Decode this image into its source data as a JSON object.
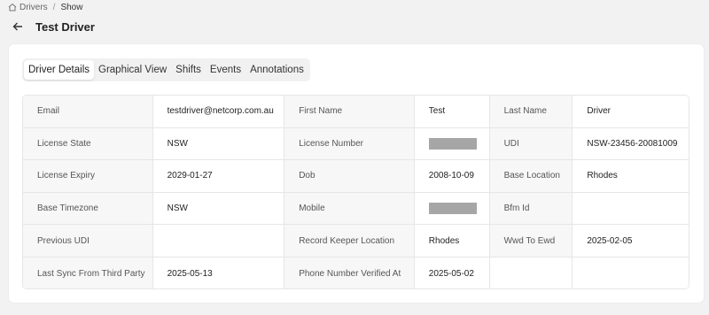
{
  "breadcrumb": {
    "root": "Drivers",
    "separator": "/",
    "current": "Show"
  },
  "page": {
    "title": "Test Driver"
  },
  "tabs": [
    {
      "label": "Driver Details",
      "active": true
    },
    {
      "label": "Graphical View",
      "active": false
    },
    {
      "label": "Shifts",
      "active": false
    },
    {
      "label": "Events",
      "active": false
    },
    {
      "label": "Annotations",
      "active": false
    }
  ],
  "details": {
    "email_label": "Email",
    "email": "testdriver@netcorp.com.au",
    "first_name_label": "First Name",
    "first_name": "Test",
    "last_name_label": "Last Name",
    "last_name": "Driver",
    "license_state_label": "License State",
    "license_state": "NSW",
    "license_number_label": "License Number",
    "udi_label": "UDI",
    "udi": "NSW-23456-20081009",
    "license_expiry_label": "License Expiry",
    "license_expiry": "2029-01-27",
    "dob_label": "Dob",
    "dob": "2008-10-09",
    "base_location_label": "Base Location",
    "base_location": "Rhodes",
    "base_timezone_label": "Base Timezone",
    "base_timezone": "NSW",
    "mobile_label": "Mobile",
    "bfm_id_label": "Bfm Id",
    "bfm_id": "",
    "previous_udi_label": "Previous UDI",
    "previous_udi": "",
    "record_keeper_location_label": "Record Keeper Location",
    "record_keeper_location": "Rhodes",
    "wwd_to_ewd_label": "Wwd To Ewd",
    "wwd_to_ewd": "2025-02-05",
    "last_sync_label": "Last Sync From Third Party",
    "last_sync": "2025-05-13",
    "phone_verified_label": "Phone Number Verified At",
    "phone_verified": "2025-05-02"
  },
  "colors": {
    "background": "#f2f2f2",
    "label_cell": "#f7f7f7",
    "redacted": "#a6a6a6"
  },
  "icons": {
    "home": "home-icon",
    "back": "arrow-left-icon"
  }
}
